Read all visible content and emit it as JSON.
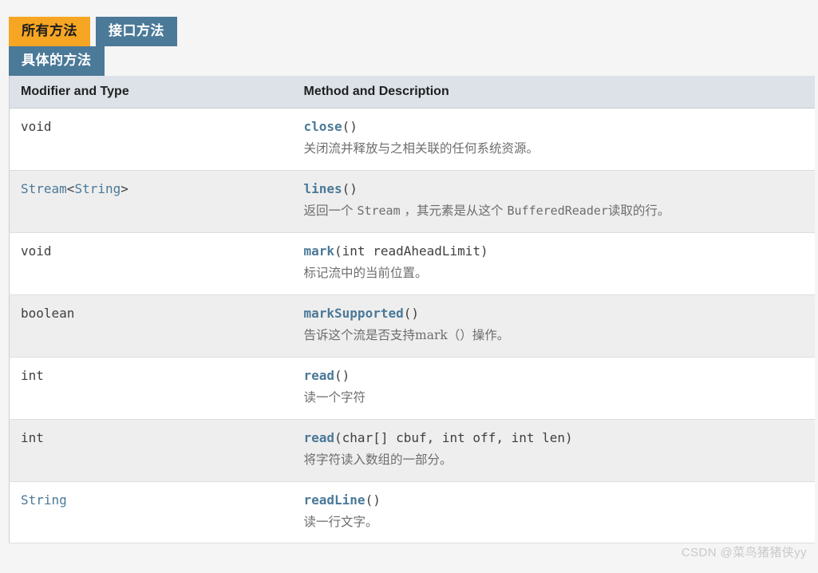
{
  "tabs": {
    "row1": [
      {
        "label": "所有方法",
        "state": "active"
      },
      {
        "label": "接口方法",
        "state": "inactive"
      }
    ],
    "row2": [
      {
        "label": "具体的方法",
        "state": "inactive"
      }
    ]
  },
  "table": {
    "headers": {
      "type": "Modifier and Type",
      "method": "Method and Description"
    },
    "rows": [
      {
        "type_pre": "void",
        "type_link": "",
        "type_post": "",
        "method_name": "close",
        "method_args": "()",
        "desc_pre": "关闭流并释放与之相关联的任何系统资源。",
        "desc_mono": "",
        "desc_post": ""
      },
      {
        "type_pre": "",
        "type_link": "Stream",
        "type_mid": "<",
        "type_link2": "String",
        "type_post": ">",
        "method_name": "lines",
        "method_args": "()",
        "desc_pre": "返回一个 ",
        "desc_mono": "Stream",
        "desc_mid": " ，其元素是从这个 ",
        "desc_mono2": "BufferedReader",
        "desc_post": "读取的行。"
      },
      {
        "type_pre": "void",
        "method_name": "mark",
        "method_args": "(int readAheadLimit)",
        "desc_pre": "标记流中的当前位置。"
      },
      {
        "type_pre": "boolean",
        "method_name": "markSupported",
        "method_args": "()",
        "desc_pre": "告诉这个流是否支持mark（）操作。"
      },
      {
        "type_pre": "int",
        "method_name": "read",
        "method_args": "()",
        "desc_pre": "读一个字符"
      },
      {
        "type_pre": "int",
        "method_name": "read",
        "method_args": "(char[] cbuf, int off, int len)",
        "desc_pre": "将字符读入数组的一部分。"
      },
      {
        "type_pre": "",
        "type_link": "String",
        "method_name": "readLine",
        "method_args": "()",
        "desc_pre": "读一行文字。"
      }
    ]
  },
  "watermark": "CSDN @菜鸟猪猪侠yy",
  "colors": {
    "tab_active": "#f6a623",
    "tab_inactive": "#4b7998",
    "header_bg": "#dde2e9",
    "link": "#4b7998",
    "row_alt_bg": "#eeeeee",
    "page_bg": "#f5f5f5"
  }
}
